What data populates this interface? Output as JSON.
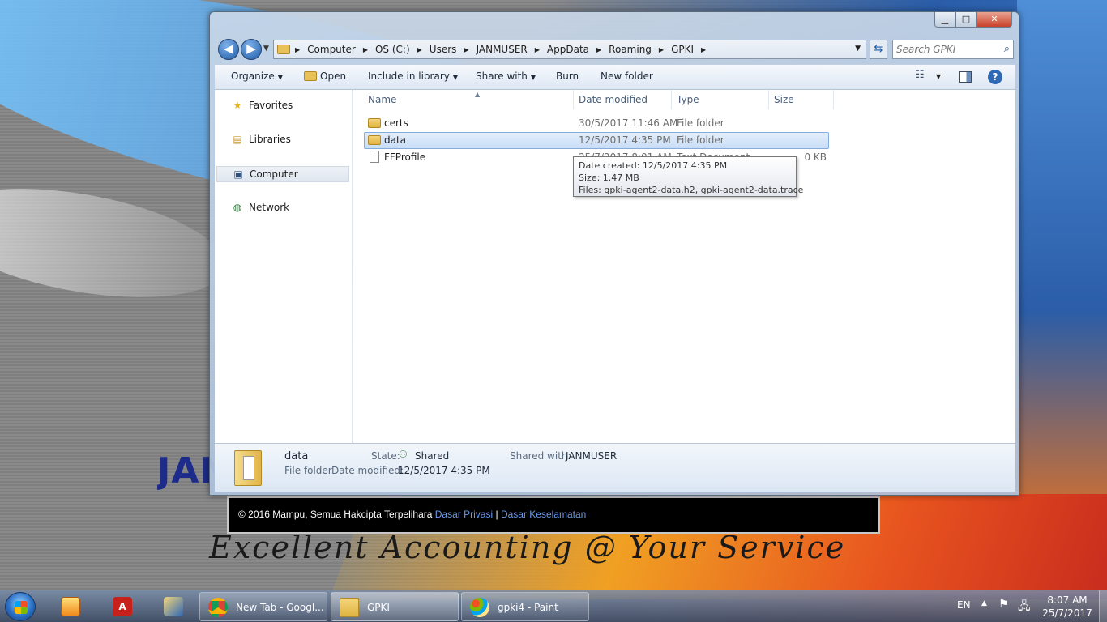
{
  "desktop": {
    "banner_text": "JAN",
    "footer": {
      "copyright": "© 2016 Mampu, Semua Hakcipta Terpelihara",
      "link_privacy": "Dasar Privasi",
      "separator": "|",
      "link_security": "Dasar Keselamatan"
    },
    "slogan": "Excellent Accounting @ Your Service"
  },
  "window": {
    "controls": {
      "minimize": "▁",
      "maximize": "□",
      "close": "✕"
    },
    "nav": {
      "back": "◀",
      "forward": "▶"
    },
    "breadcrumbs": [
      "Computer",
      "OS (C:)",
      "Users",
      "JANMUSER",
      "AppData",
      "Roaming",
      "GPKI"
    ],
    "search_placeholder": "Search GPKI",
    "toolbar": {
      "organize": "Organize",
      "open": "Open",
      "include_in_library": "Include in library",
      "share_with": "Share with",
      "burn": "Burn",
      "new_folder": "New folder"
    },
    "sidebar": {
      "favorites": "Favorites",
      "libraries": "Libraries",
      "computer": "Computer",
      "network": "Network"
    },
    "columns": {
      "name": "Name",
      "date_modified": "Date modified",
      "type": "Type",
      "size": "Size"
    },
    "files": [
      {
        "name": "certs",
        "date": "30/5/2017 11:46 AM",
        "type": "File folder",
        "size": "",
        "icon": "folder-icon"
      },
      {
        "name": "data",
        "date": "12/5/2017 4:35 PM",
        "type": "File folder",
        "size": "",
        "icon": "folder-icon",
        "selected": true
      },
      {
        "name": "FFProfile",
        "date": "25/7/2017 8:01 AM",
        "type": "Text Document",
        "size": "0 KB",
        "icon": "text-document-icon"
      }
    ],
    "tooltip": {
      "line1": "Date created: 12/5/2017 4:35 PM",
      "line2": "Size: 1.47 MB",
      "line3": "Files: gpki-agent2-data.h2, gpki-agent2-data.trace"
    },
    "details": {
      "name": "data",
      "kind": "File folder",
      "date_label": "Date modified:",
      "date_value": "12/5/2017 4:35 PM",
      "state_label": "State:",
      "state_value": "Shared",
      "shared_label": "Shared with:",
      "shared_value": "JANMUSER"
    }
  },
  "taskbar": {
    "tasks": {
      "chrome": "New Tab - Googl...",
      "explorer": "GPKI",
      "paint": "gpki4 - Paint"
    },
    "language": "EN",
    "time": "8:07 AM",
    "date": "25/7/2017"
  },
  "colors": {
    "accent": "#1e5ba8",
    "selection": "#c9ddf6",
    "link": "#6a9ae8"
  }
}
